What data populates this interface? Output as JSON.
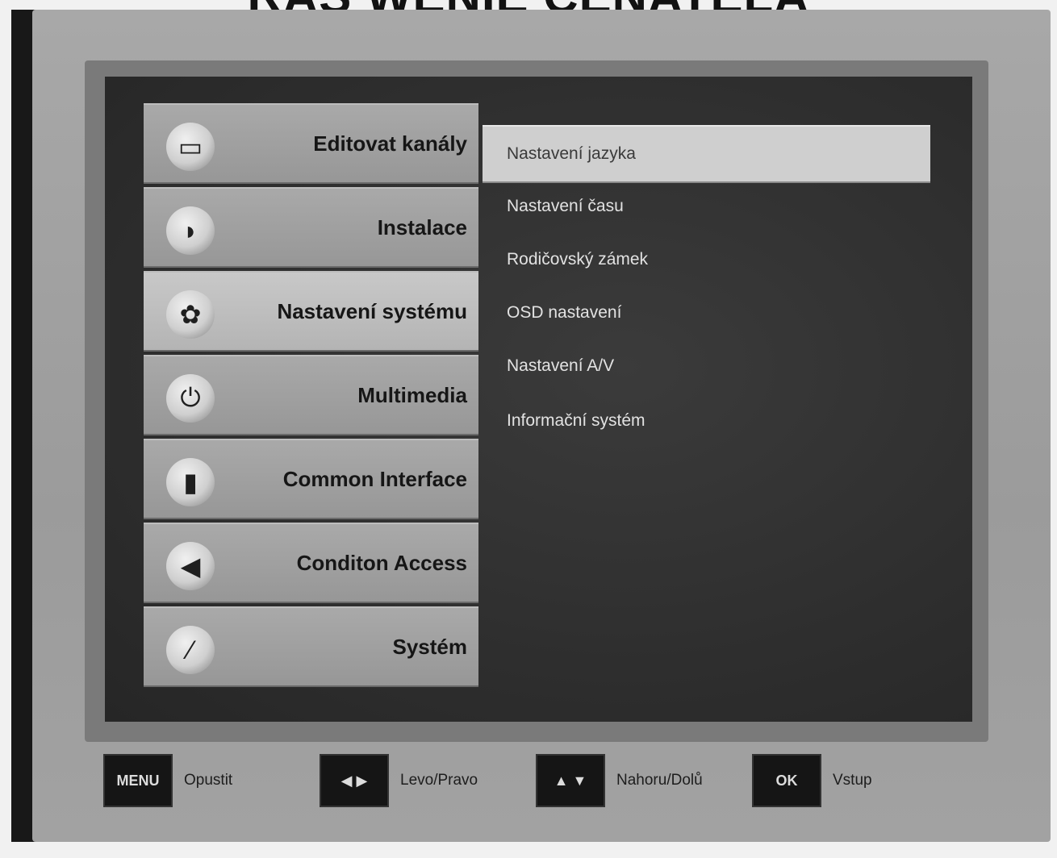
{
  "heading": "RAS WENIE CENATELA",
  "menu": {
    "items": [
      {
        "label": "Editovat kanály",
        "icon": "tv-icon"
      },
      {
        "label": "Instalace",
        "icon": "satellite-dish-icon"
      },
      {
        "label": "Nastavení systému",
        "icon": "settings-wheel-icon"
      },
      {
        "label": "Multimedia",
        "icon": "power-icon"
      },
      {
        "label": "Common Interface",
        "icon": "ci-module-icon"
      },
      {
        "label": "Conditon Access",
        "icon": "card-icon"
      },
      {
        "label": "Systém",
        "icon": "wrench-icon"
      }
    ],
    "selected_index": 2
  },
  "submenu": {
    "items": [
      "Nastavení jazyka",
      "Nastavení času",
      "Rodičovský zámek",
      "OSD nastavení",
      "Nastavení A/V",
      "Informační systém"
    ],
    "highlight_index": 0
  },
  "footer": [
    {
      "key": "MENU",
      "label": "Opustit"
    },
    {
      "key": "◀ ▶",
      "label": "Levo/Pravo"
    },
    {
      "key": "▲ ▼",
      "label": "Nahoru/Dolů"
    },
    {
      "key": "OK",
      "label": "Vstup"
    }
  ]
}
